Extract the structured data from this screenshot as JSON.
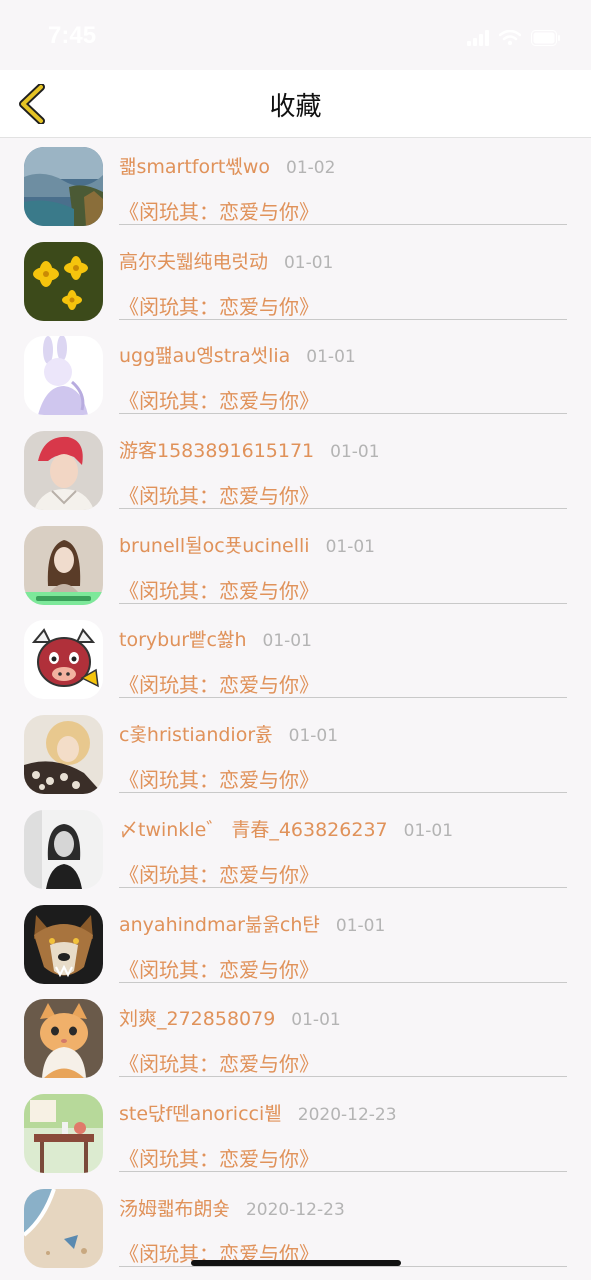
{
  "status_bar": {
    "time": "7:45"
  },
  "header": {
    "title": "收藏",
    "back_icon": "chevron-left-icon"
  },
  "favorites": [
    {
      "username": "쾗smartfort쎿wo",
      "date": "01-02",
      "title": "《闵玧其：恋爱与你》",
      "avatar": "landscape-photo"
    },
    {
      "username": "高尔夫뛟纯电럿动",
      "date": "01-01",
      "title": "《闵玧其：恋爱与你》",
      "avatar": "yellow-flowers-photo"
    },
    {
      "username": "ugg퍮au옝stra썻lia",
      "date": "01-01",
      "title": "《闵玧其：恋爱与你》",
      "avatar": "bunny-girl-illustration"
    },
    {
      "username": "游客1583891615171",
      "date": "01-01",
      "title": "《闵玧其：恋爱与你》",
      "avatar": "person-red-hair-photo"
    },
    {
      "username": "brunell뒬oc푯ucinelli",
      "date": "01-01",
      "title": "《闵玧其：恋爱与你》",
      "avatar": "girl-photo-with-caption"
    },
    {
      "username": "torybur빹c쐃h",
      "date": "01-01",
      "title": "《闵玧其：恋爱与你》",
      "avatar": "cartoon-bull-logo"
    },
    {
      "username": "c홏hristiandior흀",
      "date": "01-01",
      "title": "《闵玧其：恋爱与你》",
      "avatar": "blonde-woman-photo"
    },
    {
      "username": "〆twinkle゛ 青春_463826237",
      "date": "01-01",
      "title": "《闵玧其：恋爱与你》",
      "avatar": "girl-bw-photo"
    },
    {
      "username": "anyahindmar붊욹ch탼",
      "date": "01-01",
      "title": "《闵玧其：恋爱与你》",
      "avatar": "wolf-photo"
    },
    {
      "username": "刘爽_272858079",
      "date": "01-01",
      "title": "《闵玧其：恋爱与你》",
      "avatar": "cat-photo"
    },
    {
      "username": "ste댟f뗀anoricci뷑",
      "date": "2020-12-23",
      "title": "《闵玧其：恋爱与你》",
      "avatar": "cafe-table-photo"
    },
    {
      "username": "汤姆쾗布朗숓",
      "date": "2020-12-23",
      "title": "《闵玧其：恋爱与你》",
      "avatar": "beach-sand-photo"
    }
  ],
  "colors": {
    "accent": "#e0925a",
    "date": "#b4b4b4",
    "background": "#f8f6f8",
    "back_icon": "#e5c325"
  }
}
